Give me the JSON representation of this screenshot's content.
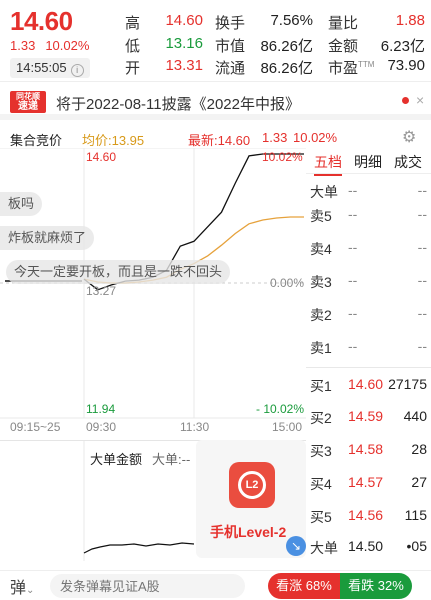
{
  "quote": {
    "price": "14.60",
    "change": "1.33",
    "change_pct": "10.02%",
    "time": "14:55:05",
    "stats": [
      {
        "label": "高",
        "value": "14.60",
        "color": "red"
      },
      {
        "label": "换手",
        "value": "7.56%",
        "color": "dark"
      },
      {
        "label": "量比",
        "value": "1.88",
        "color": "red"
      },
      {
        "label": "低",
        "value": "13.16",
        "color": "green"
      },
      {
        "label": "市值",
        "value": "86.26亿",
        "color": "dark"
      },
      {
        "label": "金额",
        "value": "6.23亿",
        "color": "dark"
      },
      {
        "label": "开",
        "value": "13.31",
        "color": "red"
      },
      {
        "label": "流通",
        "value": "86.26亿",
        "color": "dark"
      },
      {
        "label": "市盈",
        "value": "73.90",
        "color": "dark"
      }
    ],
    "pe_tag": "TTM"
  },
  "news": {
    "logo_top": "同花顺",
    "logo_bottom": "速递",
    "text": "将于2022-08-11披露《2022年中报》",
    "close": "×"
  },
  "chart_header": {
    "auction": "集合竞价",
    "avg": "均价:13.95",
    "latest": "最新:14.60",
    "latest_chg": "1.33",
    "latest_pct": "10.02%"
  },
  "chart_labels": {
    "high": "14.60",
    "high_pct": "10.02%",
    "mid": "13.27",
    "mid_pct": "0.00%",
    "low": "11.94",
    "low_pct": "- 10.02%",
    "time_auction": "09:15~25",
    "time_open": "09:30",
    "time_mid": "11:30",
    "time_close": "15:00"
  },
  "chart_data": {
    "type": "line",
    "ylim": [
      11.94,
      14.6
    ],
    "series": [
      {
        "name": "price",
        "x": [
          "09:30",
          "09:45",
          "10:00",
          "10:15",
          "10:30",
          "10:45",
          "11:00",
          "11:15",
          "11:30",
          "13:15",
          "13:30",
          "13:45",
          "14:00",
          "14:15",
          "14:30",
          "14:45",
          "15:00"
        ],
        "values": [
          13.31,
          13.2,
          13.25,
          13.29,
          13.3,
          13.33,
          13.4,
          13.65,
          13.7,
          13.85,
          14.0,
          14.3,
          14.58,
          14.6,
          14.6,
          14.6,
          14.6
        ]
      },
      {
        "name": "avg",
        "x": [
          "09:30",
          "09:45",
          "10:00",
          "10:15",
          "10:30",
          "10:45",
          "11:00",
          "11:15",
          "11:30",
          "13:15",
          "13:30",
          "13:45",
          "14:00",
          "14:15",
          "14:30",
          "14:45",
          "15:00"
        ],
        "values": [
          13.31,
          13.28,
          13.27,
          13.27,
          13.28,
          13.3,
          13.33,
          13.41,
          13.47,
          13.55,
          13.66,
          13.78,
          13.88,
          13.92,
          13.94,
          13.95,
          13.95
        ]
      }
    ]
  },
  "book": {
    "tabs": [
      "五档",
      "明细",
      "成交"
    ],
    "top_big": {
      "label": "大单",
      "price": "--",
      "qty": "--"
    },
    "asks": [
      {
        "label": "卖5",
        "price": "--",
        "qty": "--"
      },
      {
        "label": "卖4",
        "price": "--",
        "qty": "--"
      },
      {
        "label": "卖3",
        "price": "--",
        "qty": "--"
      },
      {
        "label": "卖2",
        "price": "--",
        "qty": "--"
      },
      {
        "label": "卖1",
        "price": "--",
        "qty": "--"
      }
    ],
    "bids": [
      {
        "label": "买1",
        "price": "14.60",
        "qty": "27175"
      },
      {
        "label": "买2",
        "price": "14.59",
        "qty": "440"
      },
      {
        "label": "买3",
        "price": "14.58",
        "qty": "28"
      },
      {
        "label": "买4",
        "price": "14.57",
        "qty": "27"
      },
      {
        "label": "买5",
        "price": "14.56",
        "qty": "115"
      }
    ],
    "bottom_big": {
      "label": "大单",
      "price": "14.50",
      "qty": "•05"
    }
  },
  "subchart": {
    "label": "大单金额",
    "label2": "大单:--"
  },
  "l2_card": {
    "logo": "L2",
    "text": "手机Level-2"
  },
  "danmaku": [
    "板吗",
    "炸板就麻烦了",
    "今天一定要开板，而且是一跌不回头"
  ],
  "bottom": {
    "danmu_icon": "弹",
    "input_placeholder": "发条弹幕见证A股",
    "bull": "看涨 68%",
    "bear": "看跌 32%"
  }
}
